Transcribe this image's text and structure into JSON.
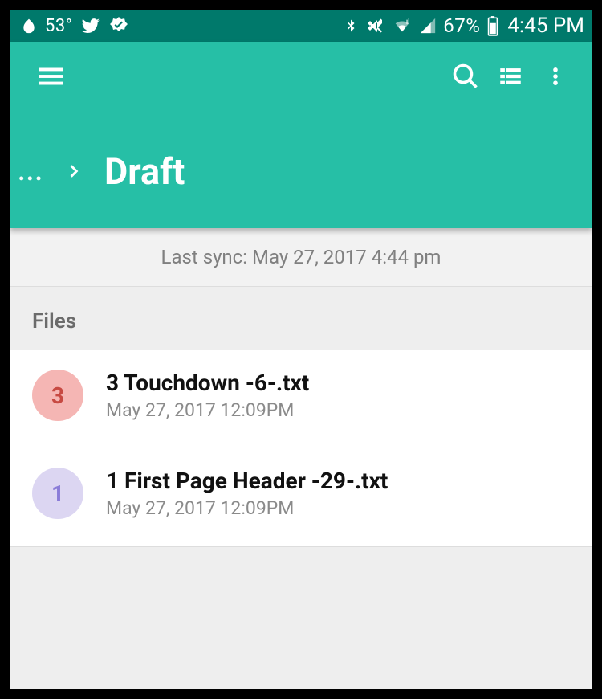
{
  "status": {
    "temperature": "53°",
    "battery_pct": "67%",
    "time": "4:45 PM"
  },
  "breadcrumb": {
    "prev": "...",
    "current": "Draft"
  },
  "sync_text": "Last sync: May 27, 2017 4:44 pm",
  "section_label": "Files",
  "files": [
    {
      "badge": "3",
      "badge_color": "red",
      "name": "3 Touchdown -6-.txt",
      "date": "May 27, 2017 12:09PM"
    },
    {
      "badge": "1",
      "badge_color": "purple",
      "name": "1 First Page Header -29-.txt",
      "date": "May 27, 2017 12:09PM"
    }
  ]
}
